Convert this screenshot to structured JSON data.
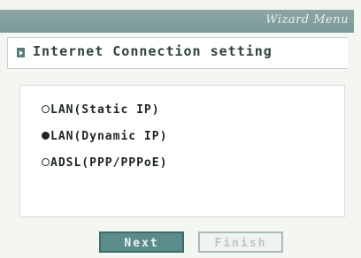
{
  "window": {
    "title": "Wizard Menu"
  },
  "section": {
    "title": "Internet Connection setting"
  },
  "options": [
    {
      "label": "LAN(Static IP)",
      "selected": false
    },
    {
      "label": "LAN(Dynamic IP)",
      "selected": true
    },
    {
      "label": "ADSL(PPP/PPPoE)",
      "selected": false
    }
  ],
  "buttons": {
    "next_label": "Next",
    "finish_label": "Finish",
    "finish_enabled": false
  },
  "colors": {
    "title_bar": "#8aa5a4",
    "next_button": "#5b8c8a",
    "finish_button_border": "#a9bcb9"
  }
}
